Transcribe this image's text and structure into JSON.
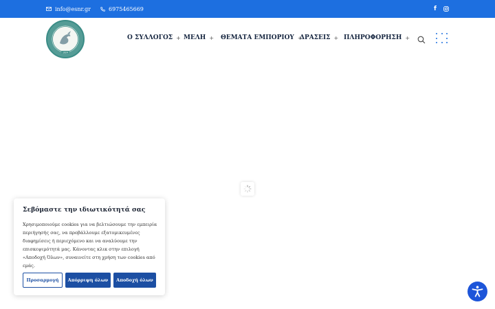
{
  "topbar": {
    "email": "info@esnr.gr",
    "phone": "6975465669",
    "background": "#1d6fe0"
  },
  "logo": {
    "alt_text": "ΕΜΠΟΡΙΚΟΣ ΣΥΛΛΟΓΟΣ ΡΟΔΟΥ 1924"
  },
  "nav": {
    "items": [
      {
        "label": "Ο ΣΥΛΛΟΓΟΣ",
        "expand": "+"
      },
      {
        "label": "ΜΕΛΗ",
        "expand": "+"
      },
      {
        "label": "ΘΕΜΑΤΑ ΕΜΠΟΡΙΟΥ",
        "expand": "+"
      },
      {
        "label": "ΔΡΑΣΕΙΣ",
        "expand": "+"
      },
      {
        "label": "ΠΛΗΡΟΦΟΡΗΣΗ",
        "expand": "+"
      }
    ],
    "text_color": "#15253f",
    "accent": "#1d6fe0"
  },
  "cookie": {
    "title": "Σεβόμαστε την ιδιωτικότητά σας",
    "body": "Χρησιμοποιούμε cookies για να βελτιώσουμε την εμπειρία περιήγησής σας, να προβάλλουμε εξατομικευμένες διαφημίσεις ή περιεχόμενο και να αναλύουμε την επισκεψιμότητά μας. Κάνοντας κλικ στην επιλογή «Αποδοχή Όλων», συναινείτε στη χρήση των cookies από εμάς.",
    "customize_label": "Προσαρμογή",
    "reject_label": "Απόρριψη όλων",
    "accept_label": "Αποδοχή όλων",
    "button_color": "#1c4fa3"
  },
  "icons": {
    "email": "envelope-icon",
    "phone": "phone-icon",
    "facebook": "facebook-icon",
    "instagram": "instagram-icon",
    "search": "search-icon",
    "menu": "grid-dots-icon",
    "loader": "spinner-icon",
    "accessibility": "accessibility-icon"
  }
}
